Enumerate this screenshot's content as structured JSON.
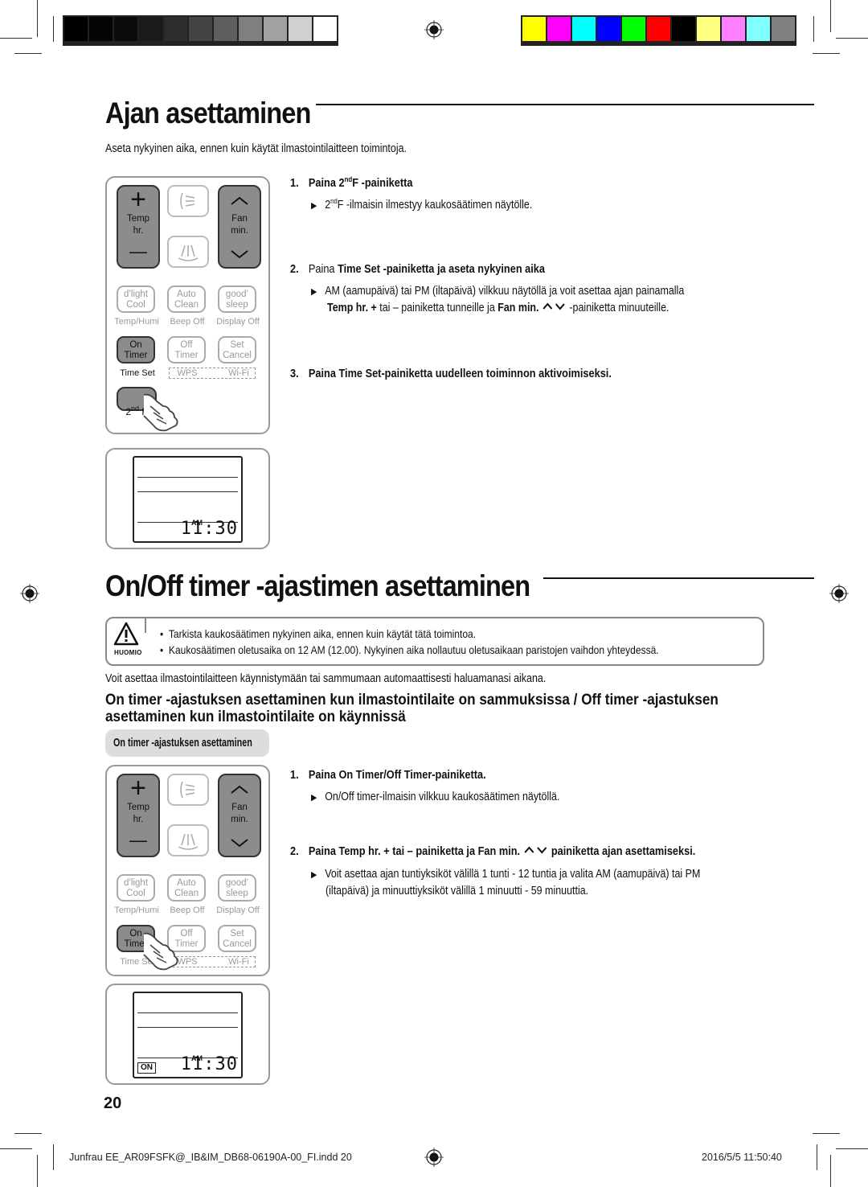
{
  "color_bars": {
    "grayscale": [
      "#000000",
      "#050505",
      "#0c0c0c",
      "#1a1a1a",
      "#2c2c2c",
      "#444444",
      "#5e5e5e",
      "#7f7f7f",
      "#a1a1a1",
      "#d0d0d0",
      "#ffffff"
    ],
    "process": [
      "#ffff00",
      "#ff00ff",
      "#00ffff",
      "#0000ff",
      "#00ff00",
      "#ff0000",
      "#000000",
      "#ffff80",
      "#ff80ff",
      "#80ffff",
      "#808080"
    ]
  },
  "section1": {
    "title": "Ajan asettaminen",
    "intro": "Aseta nykyinen aika, ennen kuin käytät ilmastointilaitteen toimintoja.",
    "steps": [
      {
        "num": "1.",
        "pre": "Paina ",
        "bold": "2",
        "bold_sup": "nd",
        "bold_after": "F",
        "post": " -painiketta",
        "bullet": {
          "sup_pre": "2",
          "sup": "nd",
          "text": "F -ilmaisin ilmestyy kaukosäätimen näytölle."
        }
      },
      {
        "num": "2.",
        "pre": "Paina ",
        "bold": "Time Set",
        "post": " -painiketta ja aseta nykyinen aika",
        "bullet": {
          "line1": "AM (aamupäivä) tai PM (iltapäivä) vilkkuu näytöllä ja voit asettaa ajan painamalla",
          "line2_bold1": "Temp hr. +",
          "line2_mid": " tai – painiketta tunneille ja ",
          "line2_bold2": "Fan min.",
          "line2_arrows": "⌃⌄",
          "line2_post": "  -painiketta minuuteille."
        }
      },
      {
        "num": "3.",
        "pre": "Paina ",
        "bold": "Time Set",
        "post": "-painiketta uudelleen toiminnon aktivoimiseksi."
      }
    ]
  },
  "remote": {
    "temp_label": "Temp\nhr.",
    "fan_label": "Fan\nmin.",
    "plus": "+",
    "minus": "—",
    "up": "︿",
    "down": "﹀",
    "row1": [
      {
        "label": "d’light\nCool",
        "under": "Temp/Humi"
      },
      {
        "label": "Auto\nClean",
        "under": "Beep Off"
      },
      {
        "label": "good’\nsleep",
        "under": "Display Off"
      }
    ],
    "row2": [
      {
        "label": "On\nTimer",
        "under": "Time Set"
      },
      {
        "label": "Off\nTimer",
        "under": "WPS"
      },
      {
        "label": "Set\nCancel",
        "under": "Wi-Fi"
      }
    ],
    "second_f": "2",
    "second_f_sup": "nd",
    "second_f_post": " F"
  },
  "lcd": {
    "ampm": "AM",
    "time": "11:30",
    "on_badge": "ON"
  },
  "section2": {
    "title": "On/Off timer -ajastimen asettaminen",
    "caution_label": "HUOMIO",
    "caution_notes": [
      "Tarkista kaukosäätimen nykyinen aika, ennen kuin käytät tätä toimintoa.",
      "Kaukosäätimen oletusaika on 12 AM (12.00). Nykyinen aika nollautuu oletusaikaan paristojen vaihdon yhteydessä."
    ],
    "intro": "Voit asettaa ilmastointilaitteen käynnistymään tai sammumaan automaattisesti haluamanasi aikana.",
    "heading_line1": "On timer -ajastuksen asettaminen kun ilmastointilaite on sammuksissa / Off timer -ajastuksen",
    "heading_line2": "asettaminen kun ilmastointilaite on käynnissä",
    "pill": "On timer -ajastuksen asettaminen",
    "steps": [
      {
        "num": "1.",
        "pre": "Paina ",
        "bold": "On Timer/Off Timer",
        "post": "-painiketta.",
        "bullet": "On/Off timer-ilmaisin vilkkuu kaukosäätimen näytöllä."
      },
      {
        "num": "2.",
        "pre": "Paina ",
        "bold": "Temp hr. + tai – painiketta ja Fan min.",
        "arrows": "⌃⌄",
        "post": "  painiketta ajan asettamiseksi.",
        "bullet_line1": "Voit asettaa ajan tuntiyksiköt välillä 1 tunti - 12 tuntia ja valita AM (aamupäivä) tai PM",
        "bullet_line2": "(iltapäivä) ja minuuttiyksiköt välillä 1 minuutti - 59 minuuttia."
      }
    ]
  },
  "footer": {
    "page_number": "20",
    "slug_left": "Junfrau EE_AR09FSFK@_IB&IM_DB68-06190A-00_FI.indd   20",
    "slug_right": "2016/5/5   11:50:40"
  }
}
